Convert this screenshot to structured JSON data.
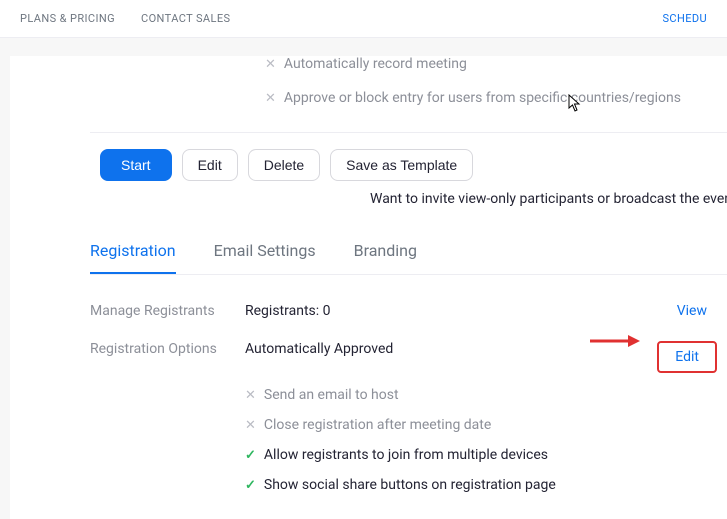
{
  "topbar": {
    "plans": "PLANS & PRICING",
    "contact": "CONTACT SALES",
    "schedule": "SCHEDU"
  },
  "meeting_options": {
    "auto_record": "Automatically record meeting",
    "approve_block": "Approve or block entry for users from specific countries/regions"
  },
  "actions": {
    "start": "Start",
    "edit": "Edit",
    "delete": "Delete",
    "save_template": "Save as Template"
  },
  "invite_note": "Want to invite view-only participants or broadcast the event to up to",
  "tabs": {
    "registration": "Registration",
    "email": "Email Settings",
    "branding": "Branding"
  },
  "registrants": {
    "label": "Manage Registrants",
    "value": "Registrants: 0",
    "view": "View"
  },
  "reg_options": {
    "label": "Registration Options",
    "value": "Automatically Approved",
    "edit": "Edit",
    "opt_email": "Send an email to host",
    "opt_close": "Close registration after meeting date",
    "opt_multi": "Allow registrants to join from multiple devices",
    "opt_social": "Show social share buttons on registration page"
  }
}
